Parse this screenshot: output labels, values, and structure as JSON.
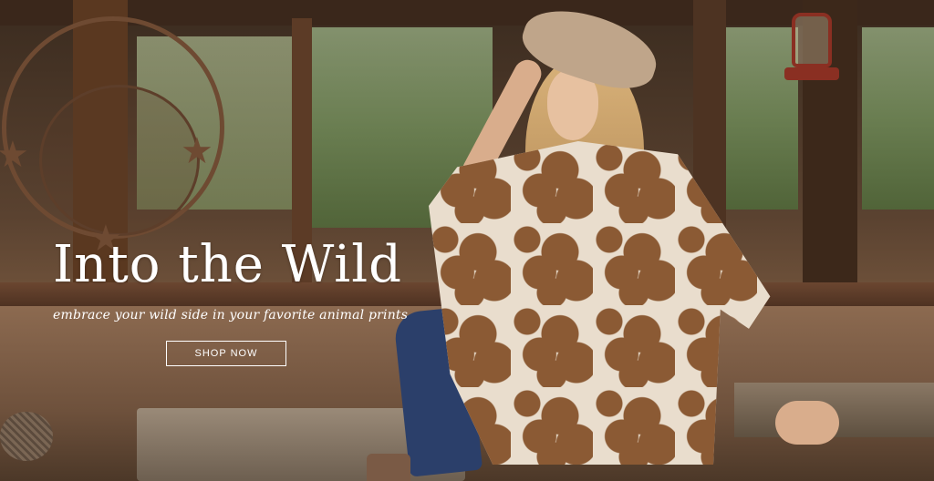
{
  "hero": {
    "headline": "Into the Wild",
    "subheadline": "embrace your wild side in your favorite animal prints",
    "cta_label": "SHOP NOW",
    "colors": {
      "text": "#ffffff",
      "button_border": "#ffffff"
    }
  }
}
